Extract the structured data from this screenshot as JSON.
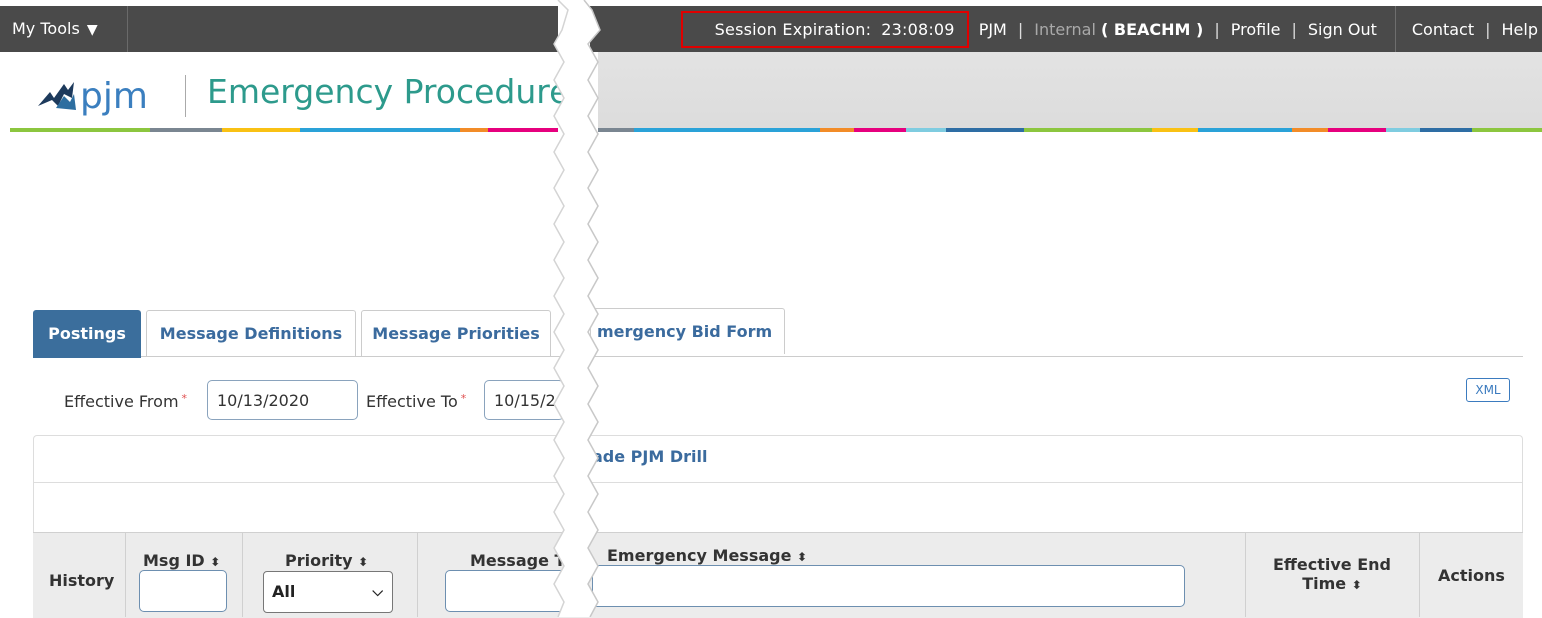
{
  "topbar": {
    "my_tools": "My Tools",
    "my_tools_caret": "▼",
    "session_label": "Session Expiration:",
    "session_time": "23:08:09",
    "company": "PJM",
    "internal": "Internal",
    "user": "( BEACHM )",
    "profile": "Profile",
    "sign_out": "Sign Out",
    "contact": "Contact",
    "help": "Help",
    "separator": "|"
  },
  "header": {
    "logo_text": "pjm",
    "app_title": "Emergency Procedures"
  },
  "tabs": [
    {
      "label": "Postings"
    },
    {
      "label": "Message Definitions"
    },
    {
      "label": "Message Priorities"
    },
    {
      "label": "mergency Bid Form"
    }
  ],
  "filters": {
    "effective_from_label": "Effective From",
    "effective_from_value": "10/13/2020",
    "effective_to_label": "Effective To",
    "effective_to_value": "10/15/2",
    "required_mark": "*",
    "xml_button": "XML"
  },
  "panel": {
    "title": "ade PJM Drill"
  },
  "table": {
    "col_history": "History",
    "col_msg_id": "Msg ID",
    "col_priority": "Priority",
    "col_message_type": "Message T",
    "col_emergency_message": "Emergency Message",
    "col_effective_end_1": "Effective End",
    "col_effective_end_2": "Time",
    "col_actions": "Actions",
    "sort_icon": "⬍",
    "priority_selected": "All"
  },
  "colors": {
    "topbar_bg": "#4a4a4a",
    "brand_teal": "#2d9a8c",
    "tab_active": "#3b6e9c",
    "session_highlight": "#e00000"
  }
}
